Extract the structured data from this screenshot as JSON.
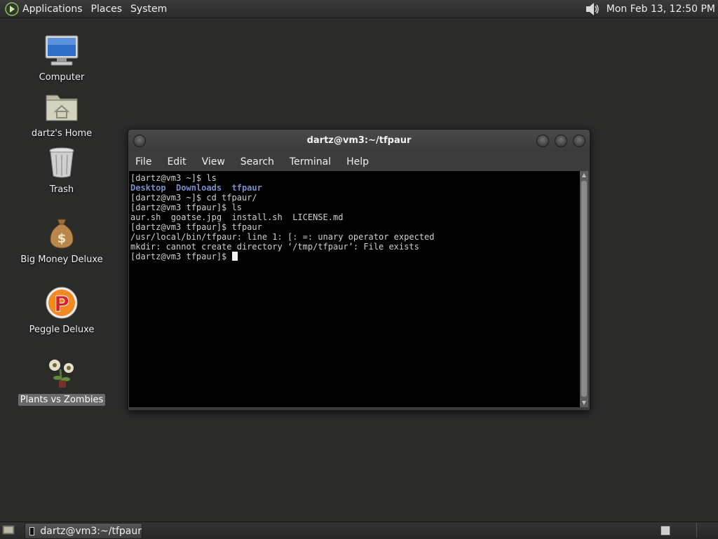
{
  "top_panel": {
    "menus": [
      "Applications",
      "Places",
      "System"
    ],
    "clock": "Mon Feb 13, 12:50 PM",
    "icons": {
      "logo": "gnome-logo-icon",
      "volume": "speaker-icon"
    }
  },
  "desktop": {
    "icons": [
      {
        "label": "Computer",
        "icon": "computer-icon"
      },
      {
        "label": "dartz's Home",
        "icon": "home-folder-icon"
      },
      {
        "label": "Trash",
        "icon": "trash-icon"
      },
      {
        "label": "Big Money Deluxe",
        "icon": "money-bag-icon"
      },
      {
        "label": "Peggle Deluxe",
        "icon": "peggle-icon"
      },
      {
        "label": "Plants vs Zombies",
        "icon": "plants-vs-zombies-icon",
        "selected": true
      }
    ]
  },
  "terminal": {
    "title": "dartz@vm3:~/tfpaur",
    "menu": [
      "File",
      "Edit",
      "View",
      "Search",
      "Terminal",
      "Help"
    ],
    "lines": [
      "[dartz@vm3 ~]$ ls",
      "Desktop  Downloads  tfpaur",
      "[dartz@vm3 ~]$ cd tfpaur/",
      "[dartz@vm3 tfpaur]$ ls",
      "aur.sh  goatse.jpg  install.sh  LICENSE.md",
      "[dartz@vm3 tfpaur]$ tfpaur",
      "/usr/local/bin/tfpaur: line 1: [: =: unary operator expected",
      "mkdir: cannot create directory ‘/tmp/tfpaur’: File exists",
      "[dartz@vm3 tfpaur]$ "
    ],
    "colors": {
      "background": "#000000",
      "text": "#cfcfcf",
      "directory": "#7b8ec9"
    }
  },
  "bottom_panel": {
    "task_label": "dartz@vm3:~/tfpaur"
  }
}
